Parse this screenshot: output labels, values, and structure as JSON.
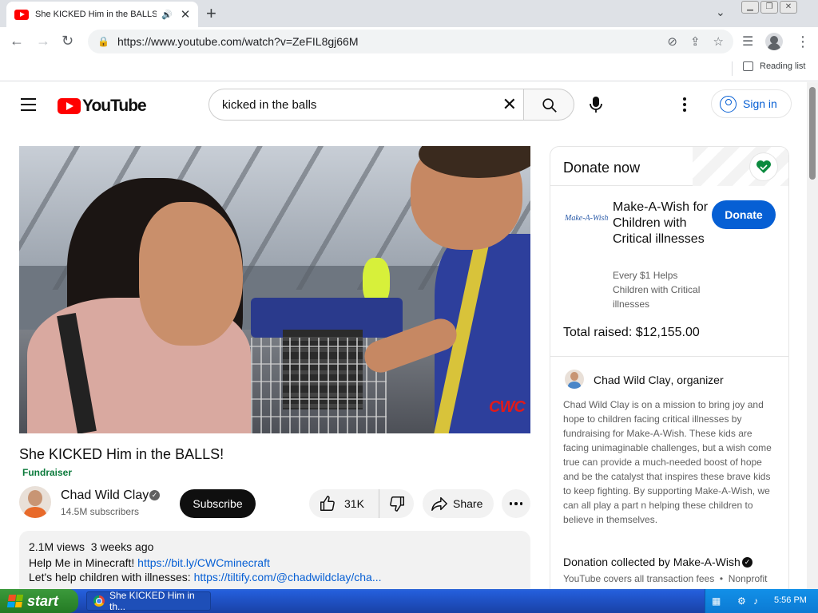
{
  "browser": {
    "tab_title": "She KICKED Him in the BALLS!",
    "tab_audio_icon": "speaker-icon",
    "tab_close_icon": "close-icon",
    "new_tab_icon": "plus-icon",
    "url": "https://www.youtube.com/watch?v=ZeFIL8gj66M",
    "reading_list": "Reading list"
  },
  "youtube": {
    "logo_text": "YouTube",
    "search_query": "kicked in the balls",
    "sign_in": "Sign in"
  },
  "video": {
    "title": "She KICKED Him in the BALLS!",
    "fundraiser_tag": "Fundraiser",
    "watermark": "CWC"
  },
  "channel": {
    "name": "Chad Wild Clay",
    "subscribers": "14.5M subscribers",
    "subscribe_label": "Subscribe"
  },
  "actions": {
    "likes": "31K",
    "share_label": "Share"
  },
  "description": {
    "meta": "2.1M views  3 weeks ago",
    "line1_text": "Help Me in Minecraft! ",
    "line1_link": "https://bit.ly/CWCminecraft",
    "line2_text": "Let's help children with illnesses: ",
    "line2_link": "https://tiltify.com/@chadwildclay/cha..."
  },
  "fundraiser": {
    "header": "Donate now",
    "charity_logo": "Make-A-Wish",
    "charity_name": "Make-A-Wish for Children with Critical illnesses",
    "donate_label": "Donate",
    "tagline": "Every $1 Helps Children with Critical illnesses",
    "total_raised": "Total raised: $12,155.00",
    "organizer_name": "Chad Wild Clay",
    "organizer_suffix": ", organizer",
    "organizer_description": "Chad Wild Clay is on a mission to bring joy and hope to children facing critical illnesses by fundraising for Make-A-Wish. These kids are facing unimaginable challenges, but a wish come true can provide a much-needed boost of hope and be the catalyst that inspires these brave kids to keep fighting. By supporting Make-A-Wish, we can all play a part n helping these children to believe in themselves.",
    "collected_by": "Donation collected by Make-A-Wish",
    "fees_line": "YouTube covers all transaction fees  •  Nonprofit website"
  },
  "taskbar": {
    "start_label": "start",
    "task_title": "She KICKED Him in th...",
    "clock": "5:56 PM"
  },
  "colors": {
    "youtube_red": "#ff0000",
    "link_blue": "#065fd4",
    "fundraiser_green": "#0b7a3b",
    "xp_start_green": "#2f8a2f",
    "xp_taskbar_blue": "#245edb"
  }
}
